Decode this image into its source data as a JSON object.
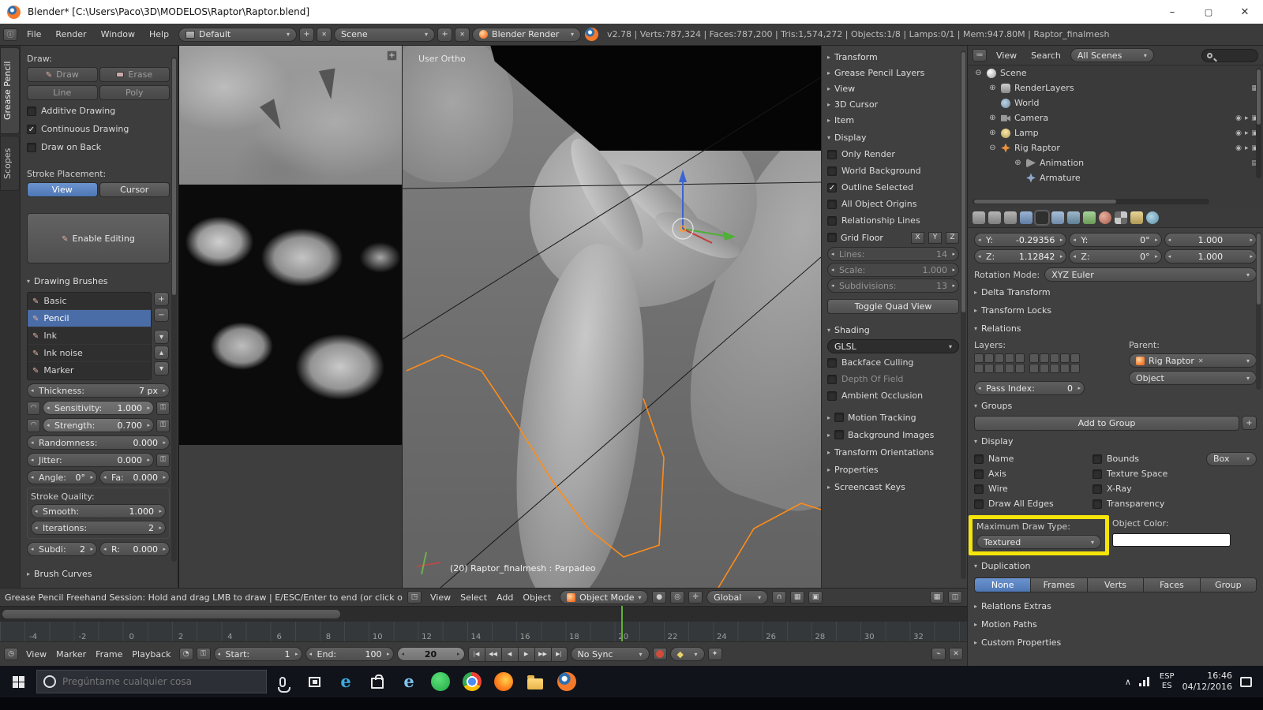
{
  "titlebar": {
    "title": "Blender* [C:\\Users\\Paco\\3D\\MODELOS\\Raptor\\Raptor.blend]"
  },
  "infobar": {
    "menus": [
      "File",
      "Render",
      "Window",
      "Help"
    ],
    "layout_value": "Default",
    "scene_value": "Scene",
    "engine_value": "Blender Render",
    "stats": "v2.78 | Verts:787,324 | Faces:787,200 | Tris:1,574,272 | Objects:1/8 | Lamps:0/1 | Mem:947.80M | Raptor_finalmesh"
  },
  "toolshelf": {
    "tabs": [
      "Grease Pencil",
      "Scopes"
    ],
    "draw_label": "Draw:",
    "btn_draw": "Draw",
    "btn_erase": "Erase",
    "btn_line": "Line",
    "btn_poly": "Poly",
    "chk_additive": "Additive Drawing",
    "chk_continuous": "Continuous Drawing",
    "chk_drawback": "Draw on Back",
    "stroke_placement": "Stroke Placement:",
    "btn_view": "View",
    "btn_cursor": "Cursor",
    "btn_enable_editing": "Enable Editing",
    "panel_drawing_brushes": "Drawing Brushes",
    "brushes": [
      "Basic",
      "Pencil",
      "Ink",
      "Ink noise",
      "Marker"
    ],
    "thickness_label": "Thickness:",
    "thickness_value": "7 px",
    "sensitivity_label": "Sensitivity:",
    "sensitivity_value": "1.000",
    "strength_label": "Strength:",
    "strength_value": "0.700",
    "randomness_label": "Randomness:",
    "randomness_value": "0.000",
    "jitter_label": "Jitter:",
    "jitter_value": "0.000",
    "angle_label": "Angle:",
    "angle_value": "0°",
    "fa_label": "Fa:",
    "fa_value": "0.000",
    "stroke_quality": "Stroke Quality:",
    "smooth_label": "Smooth:",
    "smooth_value": "1.000",
    "iterations_label": "Iterations:",
    "iterations_value": "2",
    "subd_label": "Subdi:",
    "subd_value": "2",
    "r_label": "R:",
    "r_value": "0.000",
    "panel_brush_curves": "Brush Curves"
  },
  "imageeditor": {
    "hint": "Grease Pencil Freehand Session: Hold and drag LMB to draw | E/ESC/Enter to end  (or click outside t"
  },
  "viewport": {
    "view_label": "User Ortho",
    "status_label": "(20) Raptor_finalmesh : Parpadeo",
    "menus": [
      "View",
      "Select",
      "Add",
      "Object"
    ],
    "mode_value": "Object Mode",
    "orientation_value": "Global"
  },
  "npanel": {
    "collapsed_top": [
      "Transform",
      "Grease Pencil Layers",
      "View",
      "3D Cursor",
      "Item"
    ],
    "display_panel": "Display",
    "chk_only_render": "Only Render",
    "chk_world_bg": "World Background",
    "chk_outline": "Outline Selected",
    "chk_origins": "All Object Origins",
    "chk_rel_lines": "Relationship Lines",
    "chk_grid_floor": "Grid Floor",
    "axis_x": "X",
    "axis_y": "Y",
    "axis_z": "Z",
    "lines_label": "Lines:",
    "lines_value": "14",
    "scale_label": "Scale:",
    "scale_value": "1.000",
    "subdiv_label": "Subdivisions:",
    "subdiv_value": "13",
    "btn_toggle_quad": "Toggle Quad View",
    "shading_panel": "Shading",
    "shading_mode": "GLSL",
    "chk_backface": "Backface Culling",
    "chk_dof": "Depth Of Field",
    "chk_ao": "Ambient Occlusion",
    "sec_motion_tracking": "Motion Tracking",
    "sec_background_images": "Background Images",
    "sec_transform_orientations": "Transform Orientations",
    "sec_properties": "Properties",
    "sec_screencast": "Screencast Keys"
  },
  "outliner": {
    "menu_view": "View",
    "menu_search": "Search",
    "scenes_value": "All Scenes",
    "items": [
      "Scene",
      "RenderLayers",
      "World",
      "Camera",
      "Lamp",
      "Rig Raptor",
      "Animation",
      "Armature"
    ]
  },
  "props": {
    "loc_y_label": "Y:",
    "loc_y": "-0.29356",
    "loc_z_label": "Z:",
    "loc_z": "1.12842",
    "rot_y_label": "Y:",
    "rot_y": "0°",
    "rot_z_label": "Z:",
    "rot_z": "0°",
    "scale_y": "1.000",
    "scale_z": "1.000",
    "rotation_mode_label": "Rotation Mode:",
    "rotation_mode_value": "XYZ Euler",
    "panel_delta": "Delta Transform",
    "panel_locks": "Transform Locks",
    "panel_relations": "Relations",
    "layers_label": "Layers:",
    "parent_label": "Parent:",
    "parent_value": "Rig Raptor",
    "parent_type_value": "Object",
    "pass_index_label": "Pass Index:",
    "pass_index_value": "0",
    "panel_groups": "Groups",
    "btn_add_group": "Add to Group",
    "panel_display": "Display",
    "chk_name": "Name",
    "chk_axis": "Axis",
    "chk_wire": "Wire",
    "chk_edges": "Draw All Edges",
    "chk_bounds": "Bounds",
    "bounds_value": "Box",
    "chk_texspace": "Texture Space",
    "chk_xray": "X-Ray",
    "chk_transparency": "Transparency",
    "max_draw_label": "Maximum Draw Type:",
    "max_draw_value": "Textured",
    "object_color_label": "Object Color:",
    "panel_duplication": "Duplication",
    "dup_none": "None",
    "dup_frames": "Frames",
    "dup_verts": "Verts",
    "dup_faces": "Faces",
    "dup_group": "Group",
    "panel_rel_extras": "Relations Extras",
    "panel_motion_paths": "Motion Paths",
    "panel_custom_props": "Custom Properties"
  },
  "timeline": {
    "ticks": [
      "-4",
      "-2",
      "0",
      "2",
      "4",
      "6",
      "8",
      "10",
      "12",
      "14",
      "16",
      "18",
      "20",
      "22",
      "24",
      "26",
      "28",
      "30",
      "32"
    ],
    "menus": [
      "View",
      "Marker",
      "Frame",
      "Playback"
    ],
    "start_label": "Start:",
    "start_value": "1",
    "end_label": "End:",
    "end_value": "100",
    "current_value": "20",
    "sync_value": "No Sync"
  },
  "taskbar": {
    "search_placeholder": "Pregúntame cualquier cosa",
    "lang_line1": "ESP",
    "lang_line2": "ES",
    "time": "16:46",
    "date": "04/12/2016"
  },
  "colors": {
    "accent_blue": "#4e77b5",
    "highlight_yellow": "#f5e50a",
    "selection_orange": "#ff8c19"
  }
}
